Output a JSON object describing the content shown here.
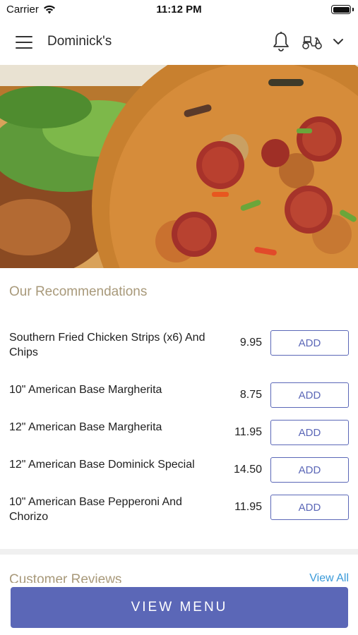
{
  "status_bar": {
    "carrier": "Carrier",
    "time": "11:12 PM",
    "battery_level": 1.0
  },
  "header": {
    "title": "Dominick's",
    "icons": [
      "hamburger-menu-icon",
      "bell-icon",
      "scooter-icon",
      "chevron-down-icon"
    ]
  },
  "recommendations": {
    "title": "Our Recommendations",
    "add_label": "ADD",
    "items": [
      {
        "name": "Southern Fried Chicken Strips (x6) And Chips",
        "price": "9.95"
      },
      {
        "name": "10\" American Base Margherita",
        "price": "8.75"
      },
      {
        "name": "12\" American Base Margherita",
        "price": "11.95"
      },
      {
        "name": "12\" American Base Dominick Special",
        "price": "14.50"
      },
      {
        "name": "10\" American Base Pepperoni And Chorizo",
        "price": "11.95"
      }
    ]
  },
  "reviews": {
    "title": "Customer Reviews",
    "view_all": "View All"
  },
  "footer": {
    "view_menu_label": "VIEW MENU"
  },
  "colors": {
    "accent": "#5b67b7",
    "section_title": "#a8997a",
    "link": "#3a9ad9"
  }
}
